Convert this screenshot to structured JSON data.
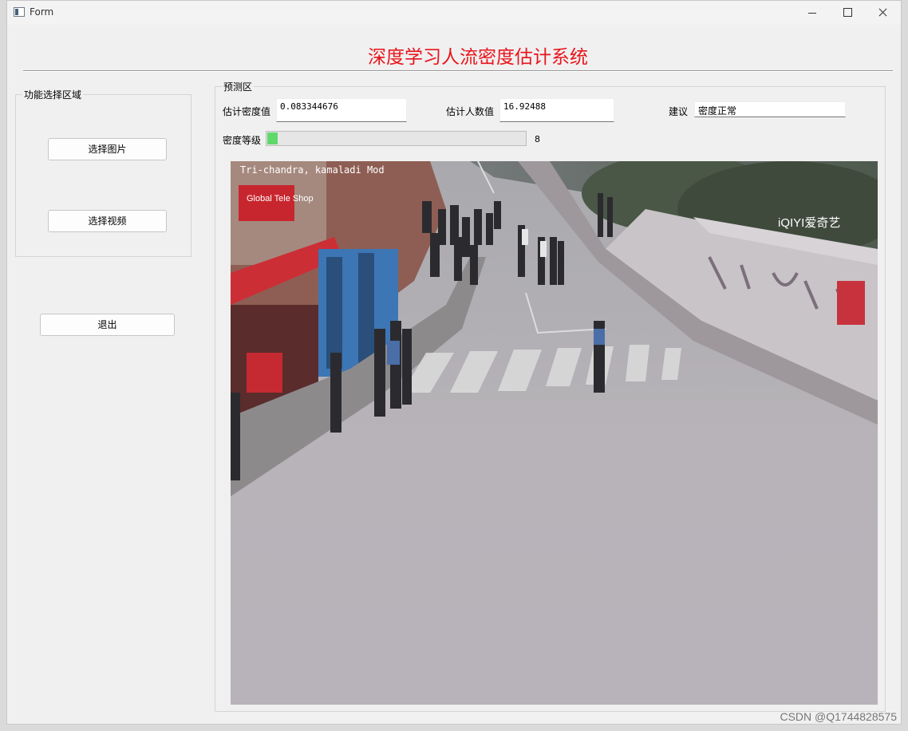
{
  "window": {
    "title": "Form"
  },
  "header": {
    "title": "深度学习人流密度估计系统"
  },
  "function_panel": {
    "title": "功能选择区域",
    "select_image": "选择图片",
    "select_video": "选择视频"
  },
  "exit_button": "退出",
  "prediction": {
    "title": "预测区",
    "density_label": "估计密度值",
    "density_value": "0.083344676",
    "count_label": "估计人数值",
    "count_value": "16.92488",
    "advice_label": "建议",
    "advice_value": "密度正常",
    "level_label": "密度等级",
    "level_value": "8",
    "level_progress": 0.04
  },
  "video_frame": {
    "caption": "Tri-chandra, kamaladi Mod",
    "logo": "iQIYI爱奇艺",
    "shop_sign": "Global Tele Shop"
  },
  "watermark": "CSDN @Q1744828575",
  "colors": {
    "title": "#e8141b",
    "progress": "#5fd96a"
  }
}
